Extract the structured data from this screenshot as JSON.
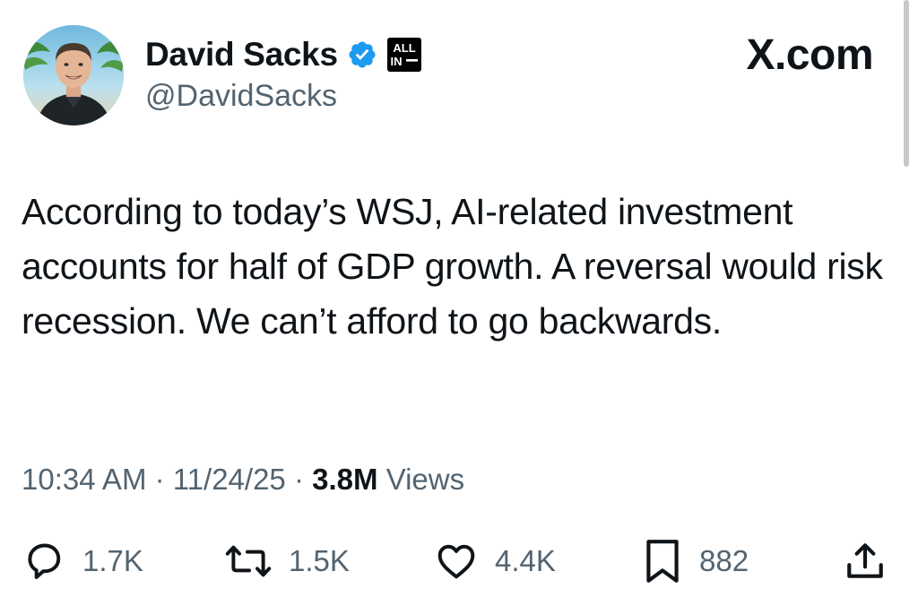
{
  "author": {
    "display_name": "David Sacks",
    "handle": "@DavidSacks",
    "verified_badge": "verified-check-icon",
    "affiliate_badge_text": "ALL IN"
  },
  "brand": "X.com",
  "tweet": {
    "text": "According to today’s WSJ, AI-related investment accounts for half of GDP growth. A reversal would risk recession. We can’t afford to go backwards."
  },
  "meta": {
    "time": "10:34 AM",
    "separator": "·",
    "date": "11/24/25",
    "views_count": "3.8M",
    "views_label": "Views"
  },
  "actions": {
    "replies": "1.7K",
    "reposts": "1.5K",
    "likes": "4.4K",
    "bookmarks": "882"
  },
  "icons": {
    "reply": "reply-icon",
    "repost": "repost-icon",
    "like": "heart-icon",
    "bookmark": "bookmark-icon",
    "share": "share-icon"
  },
  "colors": {
    "text_primary": "#0f1419",
    "text_secondary": "#536471",
    "verified_blue": "#1d9bf0"
  }
}
